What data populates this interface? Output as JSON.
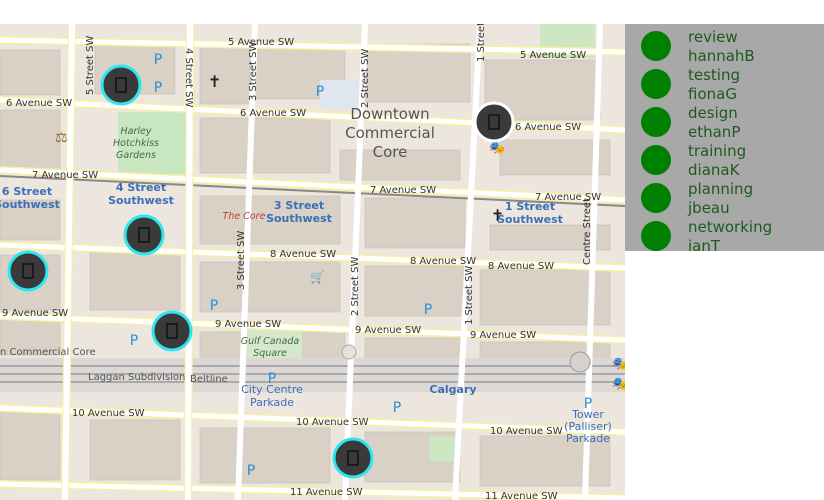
{
  "map": {
    "streets": {
      "avenue5": "5 Avenue SW",
      "avenue5_east": "5 Avenue SW",
      "avenue6": "6 Avenue SW",
      "avenue6_mid": "6 Avenue SW",
      "avenue6_east": "6 Avenue SW",
      "avenue7": "7 Avenue SW",
      "avenue7_mid": "7 Avenue SW",
      "avenue7_east": "7 Avenue SW",
      "avenue8": "8 Avenue SW",
      "avenue8_east": "8 Avenue SW",
      "avenue9": "9 Avenue SW",
      "avenue9_mid": "9 Avenue SW",
      "avenue9_mid2": "9 Avenue SW",
      "avenue9_east": "9 Avenue SW",
      "avenue10": "10 Avenue SW",
      "avenue10_mid": "10 Avenue SW",
      "avenue10_east": "10 Avenue SW",
      "avenue11": "11 Avenue SW",
      "avenue11_east": "11 Avenue SW",
      "street4": "4 Street SW",
      "street3": "3 Street SW",
      "street3b": "3 Street SW",
      "street2": "2 Street SW",
      "street2b": "2 Street SW",
      "street1": "1 Street SW",
      "street1b": "1 Street SW",
      "street5": "5 Street SW",
      "centre": "Centre Street"
    },
    "district": [
      "Downtown",
      "Commercial",
      "Core"
    ],
    "stations": {
      "s6": [
        "6 Street",
        "Southwest"
      ],
      "s4": [
        "4 Street",
        "Southwest"
      ],
      "s3": [
        "3 Street",
        "Southwest"
      ],
      "s1": [
        "1 Street",
        "Southwest"
      ],
      "calgary": "Calgary"
    },
    "parks": {
      "harley": [
        "Harley",
        "Hotchkiss",
        "Gardens"
      ],
      "gulf": [
        "Gulf Canada",
        "Square"
      ],
      "thecore": "The Core"
    },
    "pois": {
      "parkade": [
        "City Centre",
        "Parkade"
      ],
      "tower": [
        "Tower",
        "(Palliser)",
        "Parkade"
      ]
    },
    "rail": {
      "laggan": "Laggan Subdivision",
      "beltline": "Beltline",
      "commercial": "n Commercial Core"
    },
    "parking_symbol": "P"
  },
  "legend": [
    {
      "title": "review",
      "user": "hannahB",
      "color": "#008000"
    },
    {
      "title": "testing",
      "user": "fionaG",
      "color": "#008000"
    },
    {
      "title": "design",
      "user": "ethanP",
      "color": "#008000"
    },
    {
      "title": "training",
      "user": "dianaK",
      "color": "#008000"
    },
    {
      "title": "planning",
      "user": "jbeau",
      "color": "#008000"
    },
    {
      "title": "networking",
      "user": "ianT",
      "color": "#008000"
    }
  ],
  "marker_style": {
    "fill": "#3a3a3a",
    "ring": "#2ee6f0",
    "icon": "door-icon"
  }
}
